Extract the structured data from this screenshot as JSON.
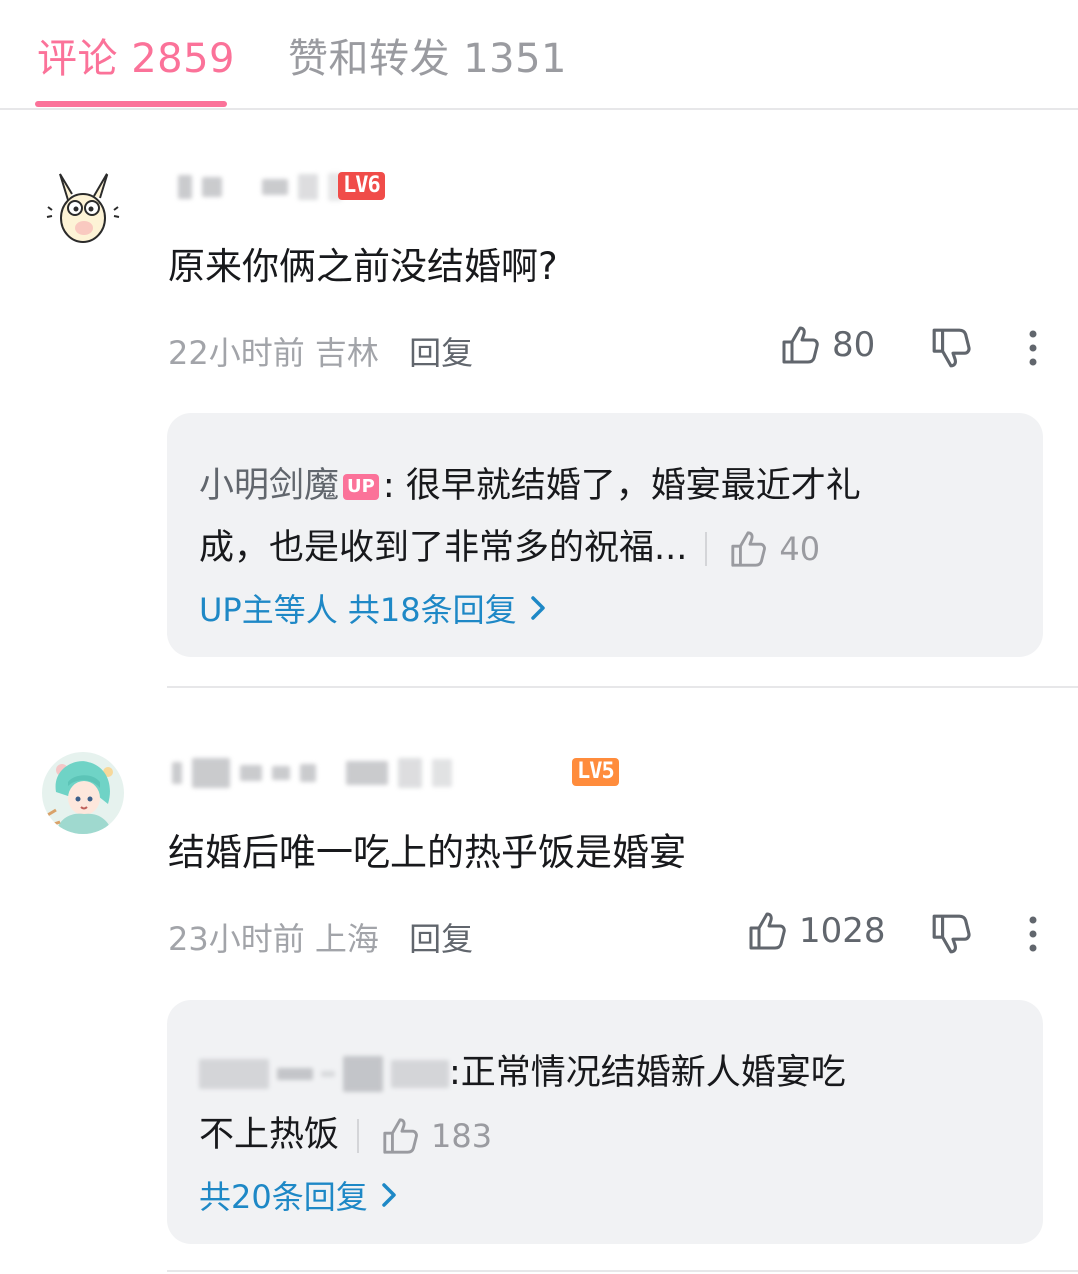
{
  "tabs": {
    "comments": "评论 2859",
    "likes_forwards": "赞和转发 1351"
  },
  "comments": [
    {
      "level": "LV6",
      "text": "原来你俩之前没结婚啊?",
      "time": "22小时前",
      "location": "吉林",
      "reply_label": "回复",
      "likes": "80",
      "sub": {
        "author": "小明剑魔",
        "up_badge": "UP",
        "line1": ": 很早就结婚了，婚宴最近才礼",
        "line2": "成，也是收到了非常多的祝福...",
        "likes": "40",
        "more": "UP主等人 共18条回复"
      }
    },
    {
      "level": "LV5",
      "text": "结婚后唯一吃上的热乎饭是婚宴",
      "time": "23小时前",
      "location": "上海",
      "reply_label": "回复",
      "likes": "1028",
      "sub": {
        "line1": ":正常情况结婚新人婚宴吃",
        "line2": "不上热饭",
        "likes": "183",
        "more": "共20条回复"
      }
    }
  ],
  "colors": {
    "accent": "#fb7299",
    "link": "#1e88c6",
    "lv6": "#f04c49",
    "lv5": "#ff8c3c"
  },
  "icons": [
    "thumbs-up-icon",
    "thumbs-down-icon",
    "more-vertical-icon",
    "chevron-right-icon"
  ]
}
